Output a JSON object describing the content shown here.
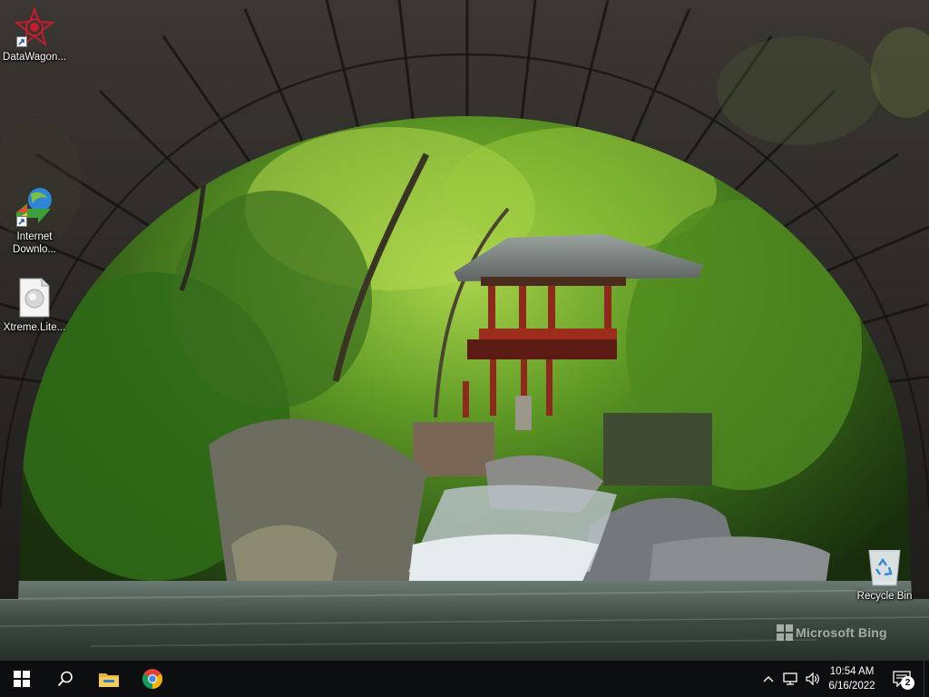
{
  "desktop": {
    "icons": [
      {
        "label": "DataWagon...",
        "icon": "datawagon-app-icon"
      },
      {
        "label": "Internet Downlo...",
        "icon": "internet-download-manager-icon"
      },
      {
        "label": "Xtreme.Lite...",
        "icon": "file-icon"
      },
      {
        "label": "Recycle Bin",
        "icon": "recycle-bin-icon"
      }
    ],
    "watermark": "Microsoft Bing"
  },
  "taskbar": {
    "start": "start-windows-icon",
    "search": "search-icon",
    "pinned": [
      "file-explorer-icon",
      "chrome-icon"
    ],
    "tray": {
      "chevron": "chevron-up-icon",
      "network": "network-icon",
      "volume": "volume-icon",
      "time": "10:54 AM",
      "date": "6/16/2022",
      "notifications_count": "2"
    }
  },
  "colors": {
    "taskbar": "#0c0e10",
    "accent_chrome_red": "#db4437",
    "accent_chrome_green": "#0f9d58",
    "accent_chrome_yellow": "#f4b400",
    "accent_chrome_blue": "#4285f4"
  }
}
